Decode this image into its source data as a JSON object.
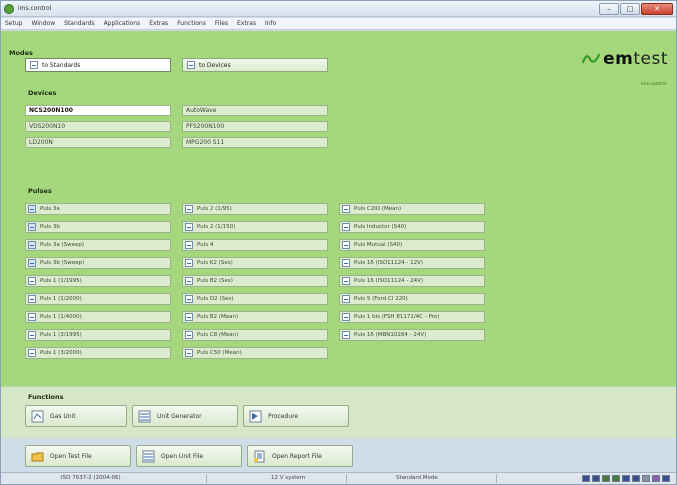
{
  "window": {
    "title": "ims.control"
  },
  "menu": [
    "Setup",
    "Window",
    "Standards",
    "Applications",
    "Extras",
    "Functions",
    "Files",
    "Extras",
    "Info"
  ],
  "modes": {
    "label": "Modes",
    "items": [
      {
        "label": "to Standards",
        "active": true
      },
      {
        "label": "to Devices",
        "active": false
      }
    ]
  },
  "brand": {
    "name_prefix": "em",
    "name_suffix": "test",
    "tagline": "ims.control"
  },
  "devices": {
    "label": "Devices",
    "col1": [
      "NCS200N100",
      "VDS200N10",
      "LD200N"
    ],
    "col2": [
      "AutoWave",
      "PFS200N100",
      "MPG200 S11"
    ]
  },
  "pulses": {
    "label": "Pulses",
    "col1": [
      "Puls 3a",
      "Puls 3b",
      "Puls 3a (Sweep)",
      "Puls 3b (Sweep)",
      "Puls 1 (1/1995)",
      "Puls 1 (1/2000)",
      "Puls 1 (1/4000)",
      "Puls 1 (3/1995)",
      "Puls 1 (3/2000)"
    ],
    "col2": [
      "Puls 2 (1/95)",
      "Puls 2 (1/150)",
      "Puls 4",
      "Puls K2 (Ses)",
      "Puls B2 (Ses)",
      "Puls D2 (Ses)",
      "Puls B2 (Mean)",
      "Puls C8 (Mean)",
      "Puls C50 (Mean)"
    ],
    "col3": [
      "Puls C2IO (Mean)",
      "Puls Inductor (S40)",
      "Puls Mutual (S40)",
      "Puls 16 (ISO11124 - 12V)",
      "Puls 16 (ISO11124 - 24V)",
      "Puls 5 (Ford CI 220)",
      "Puls 1 bis (FSH 81171/4C - Pro)",
      "Puls 16 (MBN10284 - 24V)"
    ]
  },
  "functions": {
    "label": "Functions",
    "items": [
      "Gas Unit",
      "Unit Generator",
      "Procedure"
    ]
  },
  "files": {
    "items": [
      "Open Test File",
      "Open Unit File",
      "Open Report File"
    ]
  },
  "status": {
    "standard": "ISO 7637-2 (2004-06)",
    "system": "12 V system",
    "mode": "Standard Mode"
  },
  "colors": {
    "content_bg": "#a5d77c",
    "functions_bg": "#d5e7c6",
    "brand_wave": "#3aa02a",
    "leds": [
      "#3c4f8a",
      "#3c4f8a",
      "#4a7a3a",
      "#4a7a3a",
      "#3c4f8a",
      "#3c4f8a",
      "#8a8fa3",
      "#8a5fa8",
      "#3c4f8a"
    ]
  }
}
